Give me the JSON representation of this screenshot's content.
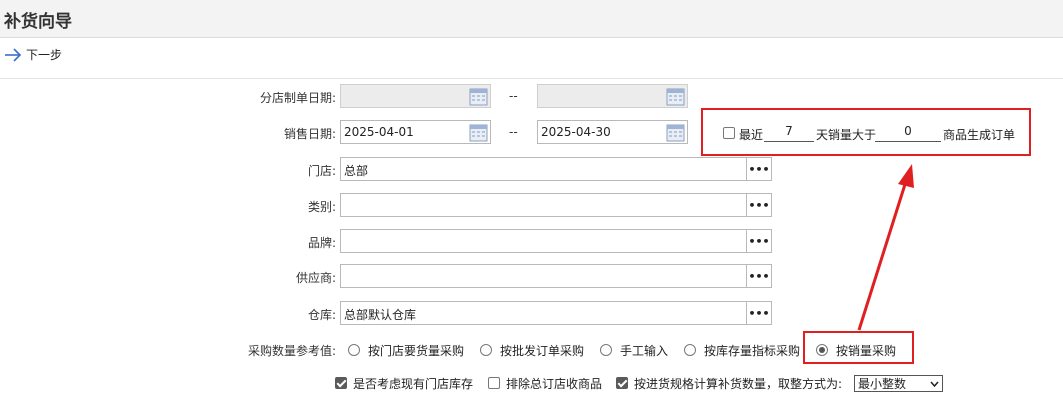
{
  "header": {
    "title": "补货向导"
  },
  "toolbar": {
    "next_label": "下一步"
  },
  "form": {
    "branch_date_label": "分店制单日期:",
    "branch_date_from": "",
    "branch_date_to": "",
    "sales_date_label": "销售日期:",
    "sales_date_from": "2025-04-01",
    "sales_date_to": "2025-04-30",
    "range_sep": "--",
    "store_label": "门店:",
    "store_value": "总部",
    "category_label": "类别:",
    "category_value": "",
    "brand_label": "品牌:",
    "brand_value": "",
    "supplier_label": "供应商:",
    "supplier_value": "",
    "warehouse_label": "仓库:",
    "warehouse_value": "总部默认仓库",
    "lookup_glyph": "•••"
  },
  "recent": {
    "label_prefix": "最近",
    "days": "7",
    "label_mid": "天销量大于",
    "qty": "0",
    "label_suffix": "商品生成订单",
    "checked": false
  },
  "reference": {
    "label": "采购数量参考值:",
    "options": [
      {
        "label": "按门店要货量采购",
        "selected": false
      },
      {
        "label": "按批发订单采购",
        "selected": false
      },
      {
        "label": "手工输入",
        "selected": false
      },
      {
        "label": "按库存量指标采购",
        "selected": false
      },
      {
        "label": "按销量采购",
        "selected": true
      }
    ]
  },
  "bottom": {
    "consider_stock": {
      "label": "是否考虑现有门店库存",
      "checked": true
    },
    "exclude_hq": {
      "label": "排除总订店收商品",
      "checked": false
    },
    "by_spec": {
      "label": "按进货规格计算补货数量，取整方式为:",
      "checked": true
    },
    "rounding_value": "最小整数"
  },
  "colors": {
    "highlight": "#e02020",
    "header_bg": "#f3f3f3"
  }
}
